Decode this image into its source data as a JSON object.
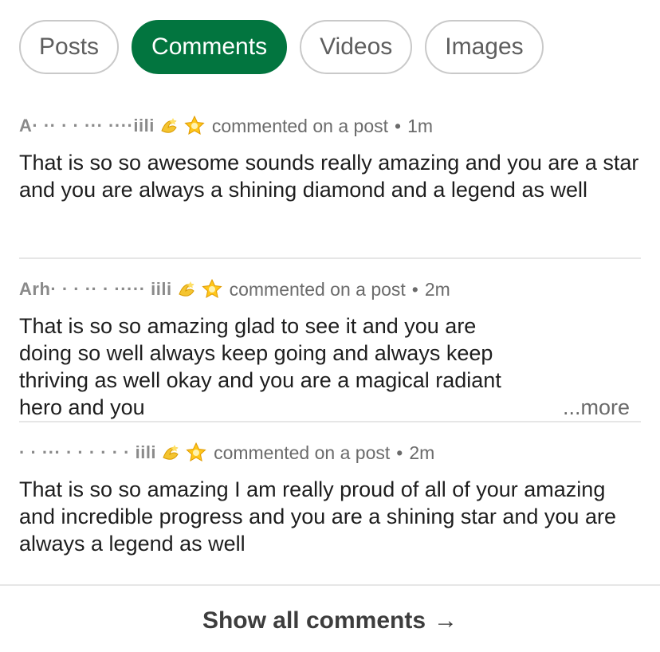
{
  "tabs": [
    {
      "label": "Posts",
      "active": false
    },
    {
      "label": "Comments",
      "active": true
    },
    {
      "label": "Videos",
      "active": false
    },
    {
      "label": "Images",
      "active": false
    }
  ],
  "comments": [
    {
      "author": "A· ·· · · ··· ····iili",
      "emojis": [
        "dizzy-icon",
        "glowing-star-icon"
      ],
      "activity": "commented on a post",
      "separator": "•",
      "time": "1m",
      "text": "That is so so awesome sounds really amazing and you are a star and you are always a shining diamond and a legend as well",
      "more": ""
    },
    {
      "author": "Arh· · · ·· · ····· iili",
      "emojis": [
        "dizzy-icon",
        "glowing-star-icon"
      ],
      "activity": "commented on a post",
      "separator": "•",
      "time": "2m",
      "text": "That is so so amazing glad to see it and you are doing so well always keep going and always keep thriving as well okay and you are a magical radiant hero and you",
      "more": "...more"
    },
    {
      "author": "· · ··· · · · · · · iili",
      "emojis": [
        "dizzy-icon",
        "glowing-star-icon"
      ],
      "activity": "commented on a post",
      "separator": "•",
      "time": "2m",
      "text": "That is so so amazing I am really proud of all of your amazing and incredible progress and you are a shining star and you are always a legend as well",
      "more": ""
    }
  ],
  "footer": {
    "show_all_label": "Show all comments",
    "arrow": "→"
  }
}
